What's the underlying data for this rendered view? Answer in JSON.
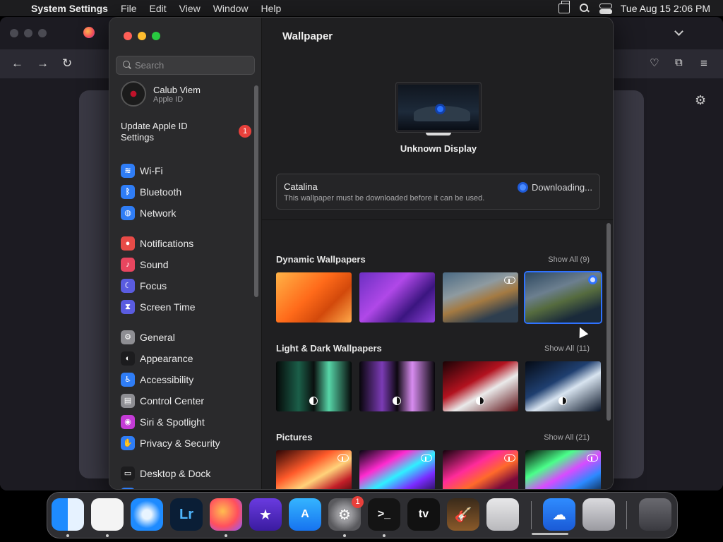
{
  "menubar": {
    "app_name": "System Settings",
    "menus": [
      "File",
      "Edit",
      "View",
      "Window",
      "Help"
    ],
    "clock": "Tue Aug 15  2:06 PM"
  },
  "sidebar": {
    "search_placeholder": "Search",
    "account": {
      "name": "Calub Viem",
      "subtitle": "Apple ID"
    },
    "update": {
      "label": "Update Apple ID Settings",
      "badge": "1"
    },
    "items": [
      {
        "label": "Wi-Fi",
        "icon": "wifi-icon",
        "color": "#2f7df6"
      },
      {
        "label": "Bluetooth",
        "icon": "bluetooth-icon",
        "color": "#2f7df6"
      },
      {
        "label": "Network",
        "icon": "globe-icon",
        "color": "#2f7df6"
      },
      {
        "label": "Notifications",
        "icon": "bell-icon",
        "color": "#e84b47"
      },
      {
        "label": "Sound",
        "icon": "speaker-icon",
        "color": "#e8465f"
      },
      {
        "label": "Focus",
        "icon": "moon-icon",
        "color": "#5a5ce0"
      },
      {
        "label": "Screen Time",
        "icon": "hourglass-icon",
        "color": "#5a5ce0"
      },
      {
        "label": "General",
        "icon": "gear-icon",
        "color": "#8e8e93"
      },
      {
        "label": "Appearance",
        "icon": "appearance-icon",
        "color": "#1c1c1e"
      },
      {
        "label": "Accessibility",
        "icon": "accessibility-icon",
        "color": "#2f7df6"
      },
      {
        "label": "Control Center",
        "icon": "control-center-icon",
        "color": "#8e8e93"
      },
      {
        "label": "Siri & Spotlight",
        "icon": "siri-icon",
        "color": "#c43bd6"
      },
      {
        "label": "Privacy & Security",
        "icon": "hand-icon",
        "color": "#2f7df6"
      },
      {
        "label": "Desktop & Dock",
        "icon": "dock-icon",
        "color": "#1c1c1e"
      },
      {
        "label": "Displays",
        "icon": "display-icon",
        "color": "#2f7df6"
      }
    ]
  },
  "main": {
    "title": "Wallpaper",
    "display_name": "Unknown Display",
    "current": {
      "name": "Catalina",
      "description": "This wallpaper must be downloaded before it can be used.",
      "status": "Downloading..."
    },
    "sections": [
      {
        "title": "Dynamic Wallpapers",
        "show_all": "Show All (9)",
        "thumbs": [
          {
            "name": "ventura-orange",
            "bg": "linear-gradient(135deg,#ffb347,#ff6a1a 45%,#d2490b 70%,#ffa94a)",
            "cloud": false,
            "selected": false
          },
          {
            "name": "monterey-purple",
            "bg": "linear-gradient(135deg,#6b2fc2,#b048e8 40%,#3b1580 70%,#8c3fd9)",
            "cloud": false,
            "selected": false
          },
          {
            "name": "catalina-coast",
            "bg": "linear-gradient(160deg,#4a6a84,#8e9aa0 35%,#a47a42 55%,#2e3e4e 80%)",
            "cloud": true,
            "selected": false
          },
          {
            "name": "catalina",
            "bg": "linear-gradient(160deg,#2d4860,#6c7f8f 35%,#556b3e 55%,#1a2a3a 80%)",
            "cloud": false,
            "selected": true
          }
        ]
      },
      {
        "title": "Light & Dark Wallpapers",
        "show_all": "Show All (11)",
        "thumbs": [
          {
            "name": "mac-green",
            "bg": "linear-gradient(90deg,#050808,#1b5f49 30%,#0a0f0e 50%,#57d6a8 70%,#050808)",
            "cloud": false,
            "selected": false,
            "dm": true
          },
          {
            "name": "mac-purple",
            "bg": "linear-gradient(90deg,#07050a,#7b3bb5 30%,#0c080f 50%,#d88cf0 70%,#07050a)",
            "cloud": false,
            "selected": false,
            "dm": true
          },
          {
            "name": "mac-red",
            "bg": "linear-gradient(150deg,#1a0205,#b3121f 40%,#eaeaea 60%,#5a0a10)",
            "cloud": false,
            "selected": false,
            "dm": true
          },
          {
            "name": "mac-blue",
            "bg": "linear-gradient(150deg,#050a14,#1f3f70 40%,#d8e4f0 58%,#0b1628)",
            "cloud": false,
            "selected": false,
            "dm": true
          }
        ]
      },
      {
        "title": "Pictures",
        "show_all": "Show All (21)",
        "thumbs": [
          {
            "name": "pic-1",
            "bg": "linear-gradient(150deg,#2b0505,#ff5a2a 35%,#ffd27a 55%,#c21e28 75%,#1a0303)",
            "cloud": true,
            "selected": false
          },
          {
            "name": "pic-2",
            "bg": "linear-gradient(150deg,#050510,#ff2bd0 30%,#2ff0ff 50%,#7a2bff 70%,#050510)",
            "cloud": true,
            "selected": false
          },
          {
            "name": "pic-3",
            "bg": "linear-gradient(150deg,#12020a,#ff2b9a 35%,#ff6a2b 55%,#7a0a3a 75%)",
            "cloud": true,
            "selected": false
          },
          {
            "name": "pic-4",
            "bg": "linear-gradient(150deg,#040a06,#4bff8a 30%,#d84bff 50%,#2b8aff 70%,#050505)",
            "cloud": true,
            "selected": false
          }
        ]
      }
    ]
  },
  "dock": {
    "apps": [
      {
        "name": "finder-icon",
        "bg": "linear-gradient(90deg,#1e8bff 50%,#e6f2ff 50%)",
        "glyph": "",
        "running": true
      },
      {
        "name": "vscode-icon",
        "bg": "#f4f4f4",
        "glyph": "",
        "running": true
      },
      {
        "name": "safari-icon",
        "bg": "radial-gradient(circle,#e8f4ff 20%,#1e8bff 60%)",
        "glyph": "",
        "running": false
      },
      {
        "name": "lightroom-icon",
        "bg": "#0a1e36",
        "glyph": "Lr",
        "running": false
      },
      {
        "name": "firefox-icon",
        "bg": "radial-gradient(circle at 40% 40%,#ffbd4f,#ff4f5e 55%,#9059ff)",
        "glyph": "",
        "running": true
      },
      {
        "name": "imovie-icon",
        "bg": "linear-gradient(180deg,#6a3be0,#3a1ba0)",
        "glyph": "★",
        "running": false
      },
      {
        "name": "app-store-icon",
        "bg": "linear-gradient(180deg,#35b5ff,#1673f0)",
        "glyph": "A",
        "running": false
      },
      {
        "name": "system-settings-icon",
        "bg": "radial-gradient(circle,#9a9a9e 30%,#5a5a5e 70%)",
        "glyph": "⚙",
        "running": true,
        "badge": "1"
      },
      {
        "name": "terminal-icon",
        "bg": "#141414",
        "glyph": ">_",
        "running": true
      },
      {
        "name": "apple-tv-icon",
        "bg": "#111",
        "glyph": "tv",
        "running": false
      },
      {
        "name": "garageband-icon",
        "bg": "linear-gradient(180deg,#3a2a1a,#8a5a2a)",
        "glyph": "🎸",
        "running": false
      },
      {
        "name": "launchpad-icon",
        "bg": "linear-gradient(180deg,#e8e8ea,#b8b8bc)",
        "glyph": "",
        "running": false
      },
      {
        "name": "weather-icon",
        "bg": "linear-gradient(180deg,#2f8cff,#1a5ad6)",
        "glyph": "☁",
        "running": false
      },
      {
        "name": "downloads-icon",
        "bg": "linear-gradient(180deg,#dadade,#9a9aa0)",
        "glyph": "",
        "running": false
      },
      {
        "name": "trash-icon",
        "bg": "linear-gradient(180deg,#6a6a70,#3a3a40)",
        "glyph": "",
        "running": false
      }
    ]
  }
}
